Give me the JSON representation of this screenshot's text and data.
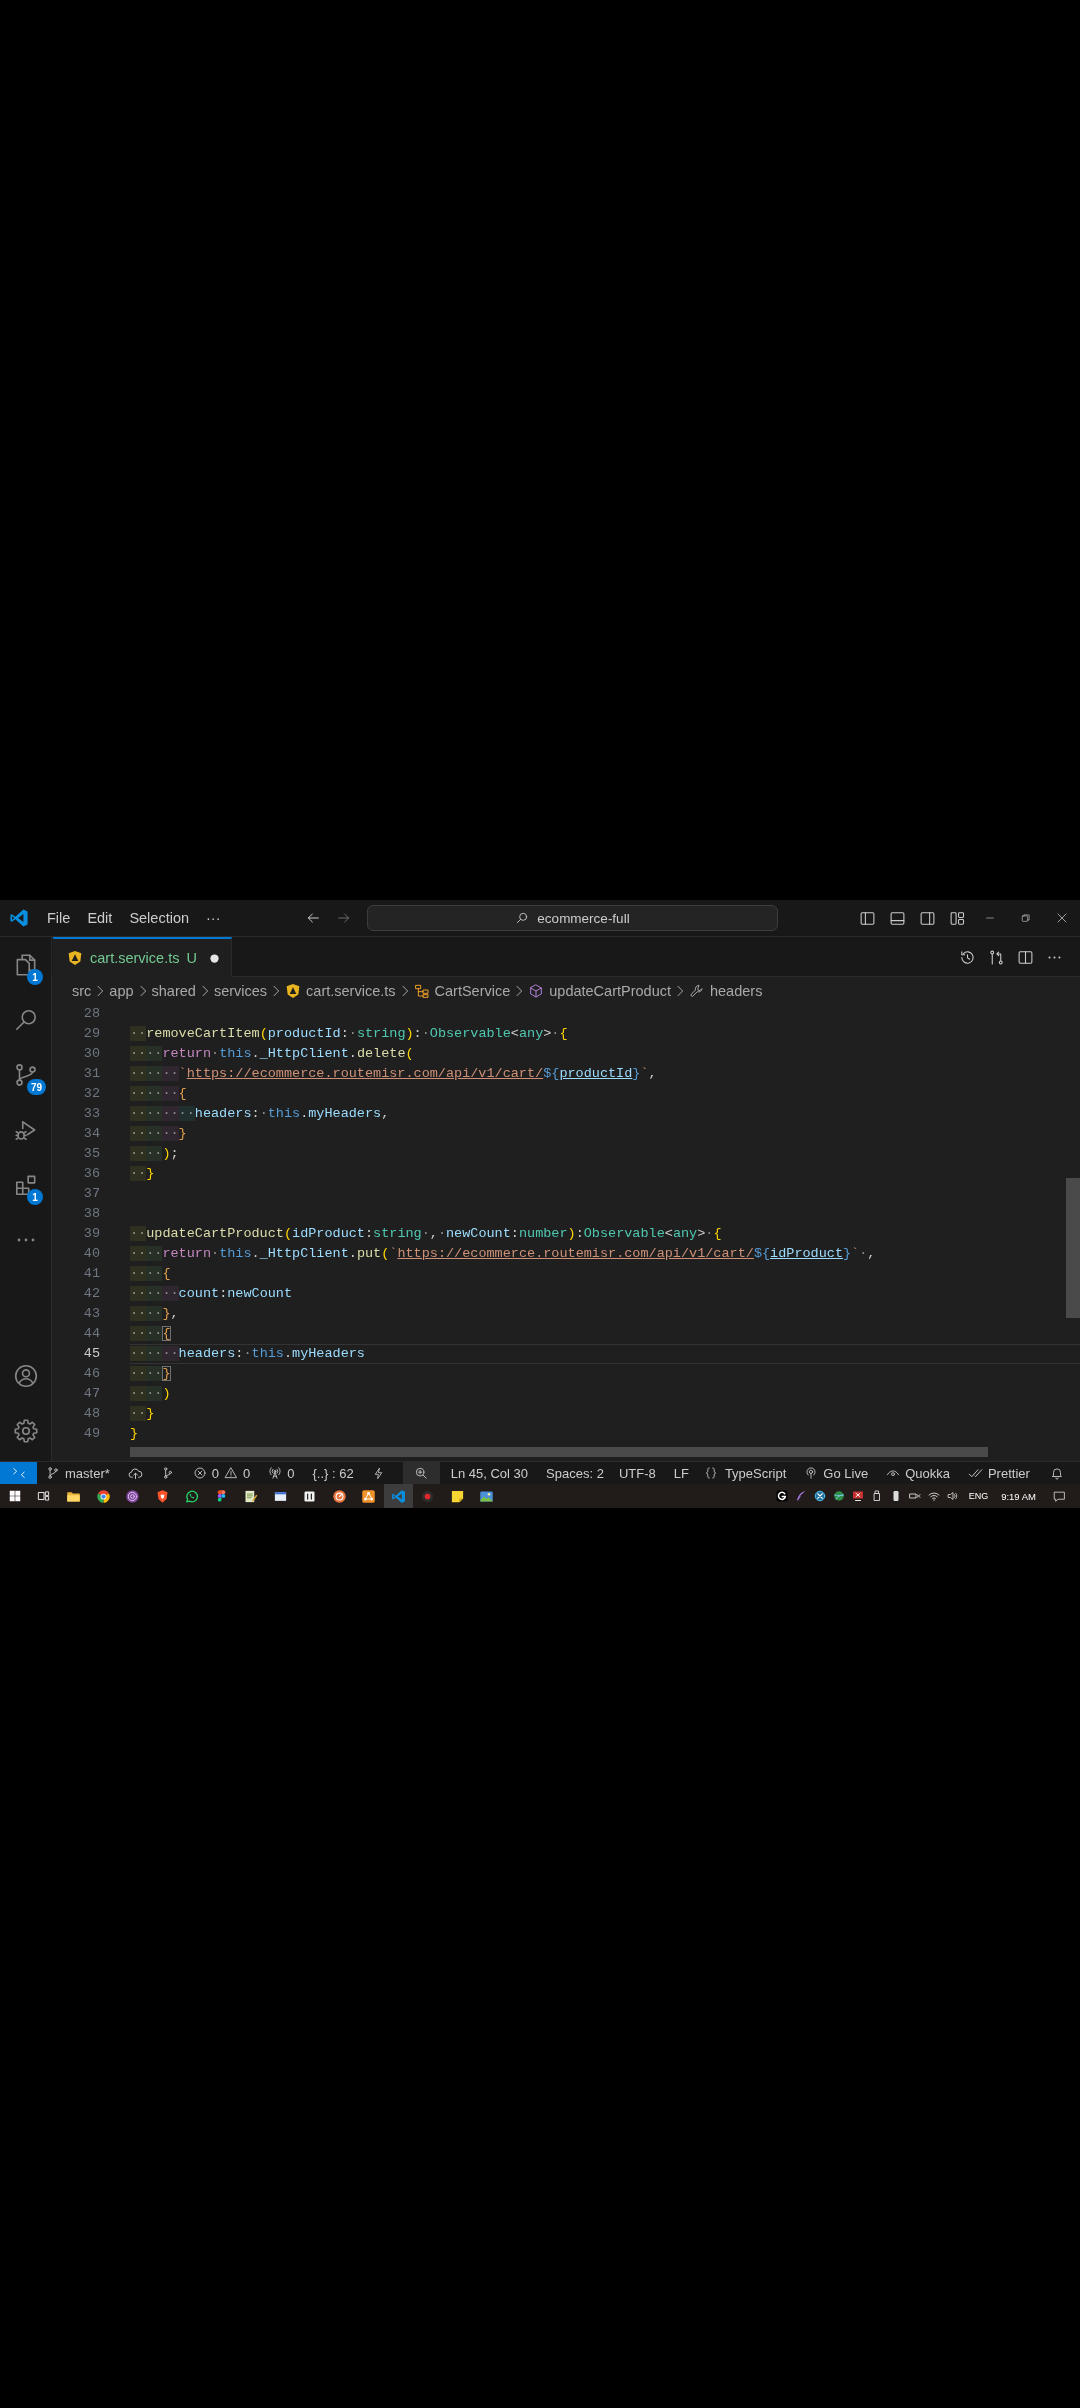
{
  "title_bar": {
    "menu": [
      {
        "label": "File"
      },
      {
        "label": "Edit"
      },
      {
        "label": "Selection"
      },
      {
        "label": "···"
      }
    ],
    "command_center": "ecommerce-full"
  },
  "activity_bar": {
    "views": [
      {
        "selected": false,
        "badge": "1"
      },
      {
        "selected": false
      },
      {
        "selected": false,
        "badge": "79"
      },
      {
        "selected": false
      },
      {
        "selected": false,
        "badge": "1"
      }
    ]
  },
  "tabs": [
    {
      "label": "cart.service.ts",
      "git_status": "U",
      "modified": true,
      "selected": true
    }
  ],
  "breadcrumbs": [
    {
      "kind": "folder",
      "label": "src"
    },
    {
      "kind": "folder",
      "label": "app"
    },
    {
      "kind": "folder",
      "label": "shared"
    },
    {
      "kind": "folder",
      "label": "services"
    },
    {
      "kind": "file",
      "label": "cart.service.ts"
    },
    {
      "kind": "class",
      "label": "CartService"
    },
    {
      "kind": "method",
      "label": "updateCartProduct"
    },
    {
      "kind": "property",
      "label": "headers"
    }
  ],
  "editor": {
    "lines": [
      {
        "number": "28",
        "current": false
      },
      {
        "number": "29",
        "current": false,
        "tokens": [
          {
            "kind": "ind",
            "text": "··"
          },
          {
            "kind": "fn",
            "text": "removeCartItem"
          },
          {
            "kind": "b1",
            "text": "("
          },
          {
            "kind": "var",
            "text": "productId"
          },
          {
            "kind": "p",
            "text": ":"
          },
          {
            "kind": "ws",
            "text": "·"
          },
          {
            "kind": "type",
            "text": "string"
          },
          {
            "kind": "b1",
            "text": ")"
          },
          {
            "kind": "p",
            "text": ":"
          },
          {
            "kind": "ws",
            "text": "·"
          },
          {
            "kind": "type",
            "text": "Observable"
          },
          {
            "kind": "p",
            "text": "<"
          },
          {
            "kind": "type",
            "text": "any"
          },
          {
            "kind": "p",
            "text": ">"
          },
          {
            "kind": "ws",
            "text": "·"
          },
          {
            "kind": "b1",
            "text": "{"
          }
        ]
      },
      {
        "number": "30",
        "current": false,
        "tokens": [
          {
            "kind": "ind",
            "text": "··"
          },
          {
            "kind": "ind",
            "text": "··"
          },
          {
            "kind": "kw",
            "text": "return"
          },
          {
            "kind": "ws",
            "text": "·"
          },
          {
            "kind": "this",
            "text": "this"
          },
          {
            "kind": "p",
            "text": "."
          },
          {
            "kind": "var",
            "text": "_HttpClient"
          },
          {
            "kind": "p",
            "text": "."
          },
          {
            "kind": "fn",
            "text": "delete"
          },
          {
            "kind": "b1",
            "text": "("
          }
        ]
      },
      {
        "number": "31",
        "current": false,
        "tokens": [
          {
            "kind": "ind",
            "text": "··"
          },
          {
            "kind": "ind",
            "text": "··"
          },
          {
            "kind": "ind",
            "text": "··"
          },
          {
            "kind": "str",
            "text": "`"
          },
          {
            "kind": "url",
            "text": "https://ecommerce.routemisr.com/api/v1/cart/"
          },
          {
            "kind": "tpl",
            "text": "${"
          },
          {
            "kind": "uvar",
            "text": "productId"
          },
          {
            "kind": "tpl",
            "text": "}"
          },
          {
            "kind": "str",
            "text": "`"
          },
          {
            "kind": "p",
            "text": ","
          }
        ]
      },
      {
        "number": "32",
        "current": false,
        "tokens": [
          {
            "kind": "ind",
            "text": "··"
          },
          {
            "kind": "ind",
            "text": "··"
          },
          {
            "kind": "ind",
            "text": "··"
          },
          {
            "kind": "b2",
            "text": "{"
          }
        ]
      },
      {
        "number": "33",
        "current": false,
        "tokens": [
          {
            "kind": "ind",
            "text": "··"
          },
          {
            "kind": "ind",
            "text": "··"
          },
          {
            "kind": "ind",
            "text": "··"
          },
          {
            "kind": "ind",
            "text": "··"
          },
          {
            "kind": "var",
            "text": "headers"
          },
          {
            "kind": "p",
            "text": ":"
          },
          {
            "kind": "ws",
            "text": "·"
          },
          {
            "kind": "this",
            "text": "this"
          },
          {
            "kind": "p",
            "text": "."
          },
          {
            "kind": "var",
            "text": "myHeaders"
          },
          {
            "kind": "p",
            "text": ","
          }
        ]
      },
      {
        "number": "34",
        "current": false,
        "tokens": [
          {
            "kind": "ind",
            "text": "··"
          },
          {
            "kind": "ind",
            "text": "··"
          },
          {
            "kind": "ind",
            "text": "··"
          },
          {
            "kind": "b2",
            "text": "}"
          }
        ]
      },
      {
        "number": "35",
        "current": false,
        "tokens": [
          {
            "kind": "ind",
            "text": "··"
          },
          {
            "kind": "ind",
            "text": "··"
          },
          {
            "kind": "b1",
            "text": ")"
          },
          {
            "kind": "p",
            "text": ";"
          }
        ]
      },
      {
        "number": "36",
        "current": false,
        "tokens": [
          {
            "kind": "ind",
            "text": "··"
          },
          {
            "kind": "b1",
            "text": "}"
          }
        ]
      },
      {
        "number": "37",
        "current": false
      },
      {
        "number": "38",
        "current": false
      },
      {
        "number": "39",
        "current": false,
        "tokens": [
          {
            "kind": "ind",
            "text": "··"
          },
          {
            "kind": "fn",
            "text": "updateCartProduct"
          },
          {
            "kind": "b1",
            "text": "("
          },
          {
            "kind": "var",
            "text": "idProduct"
          },
          {
            "kind": "p",
            "text": ":"
          },
          {
            "kind": "type",
            "text": "string"
          },
          {
            "kind": "ws",
            "text": "·"
          },
          {
            "kind": "p",
            "text": ","
          },
          {
            "kind": "ws",
            "text": "·"
          },
          {
            "kind": "var",
            "text": "newCount"
          },
          {
            "kind": "p",
            "text": ":"
          },
          {
            "kind": "type",
            "text": "number"
          },
          {
            "kind": "b1",
            "text": ")"
          },
          {
            "kind": "p",
            "text": ":"
          },
          {
            "kind": "type",
            "text": "Observable"
          },
          {
            "kind": "p",
            "text": "<"
          },
          {
            "kind": "type",
            "text": "any"
          },
          {
            "kind": "p",
            "text": ">"
          },
          {
            "kind": "ws",
            "text": "·"
          },
          {
            "kind": "b1",
            "text": "{"
          }
        ]
      },
      {
        "number": "40",
        "current": false,
        "tokens": [
          {
            "kind": "ind",
            "text": "··"
          },
          {
            "kind": "ind",
            "text": "··"
          },
          {
            "kind": "kw",
            "text": "return"
          },
          {
            "kind": "ws",
            "text": "·"
          },
          {
            "kind": "this",
            "text": "this"
          },
          {
            "kind": "p",
            "text": "."
          },
          {
            "kind": "var",
            "text": "_HttpClient"
          },
          {
            "kind": "p",
            "text": "."
          },
          {
            "kind": "fn",
            "text": "put"
          },
          {
            "kind": "b1",
            "text": "("
          },
          {
            "kind": "str",
            "text": "`"
          },
          {
            "kind": "url",
            "text": "https://ecommerce.routemisr.com/api/v1/cart/"
          },
          {
            "kind": "tpl",
            "text": "${"
          },
          {
            "kind": "uvar",
            "text": "idProduct"
          },
          {
            "kind": "tpl",
            "text": "}"
          },
          {
            "kind": "str",
            "text": "`"
          },
          {
            "kind": "ws",
            "text": "·"
          },
          {
            "kind": "p",
            "text": ","
          }
        ]
      },
      {
        "number": "41",
        "current": false,
        "tokens": [
          {
            "kind": "ind",
            "text": "··"
          },
          {
            "kind": "ind",
            "text": "··"
          },
          {
            "kind": "b2",
            "text": "{"
          }
        ]
      },
      {
        "number": "42",
        "current": false,
        "tokens": [
          {
            "kind": "ind",
            "text": "··"
          },
          {
            "kind": "ind",
            "text": "··"
          },
          {
            "kind": "ind",
            "text": "··"
          },
          {
            "kind": "var",
            "text": "count"
          },
          {
            "kind": "p",
            "text": ":"
          },
          {
            "kind": "var",
            "text": "newCount"
          }
        ]
      },
      {
        "number": "43",
        "current": false,
        "tokens": [
          {
            "kind": "ind",
            "text": "··"
          },
          {
            "kind": "ind",
            "text": "··"
          },
          {
            "kind": "b2",
            "text": "}"
          },
          {
            "kind": "p",
            "text": ","
          }
        ]
      },
      {
        "number": "44",
        "current": false,
        "tokens": [
          {
            "kind": "ind",
            "text": "··"
          },
          {
            "kind": "ind",
            "text": "··"
          },
          {
            "kind": "bm",
            "text": "{"
          }
        ]
      },
      {
        "number": "45",
        "current": true,
        "tokens": [
          {
            "kind": "ind",
            "text": "··"
          },
          {
            "kind": "ind",
            "text": "··"
          },
          {
            "kind": "ind",
            "text": "··"
          },
          {
            "kind": "var",
            "text": "headers"
          },
          {
            "kind": "p",
            "text": ":"
          },
          {
            "kind": "ws",
            "text": "·"
          },
          {
            "kind": "this",
            "text": "this"
          },
          {
            "kind": "p",
            "text": "."
          },
          {
            "kind": "var",
            "text": "myHeaders"
          }
        ]
      },
      {
        "number": "46",
        "current": false,
        "tokens": [
          {
            "kind": "ind",
            "text": "··"
          },
          {
            "kind": "ind",
            "text": "··"
          },
          {
            "kind": "bm",
            "text": "}"
          }
        ]
      },
      {
        "number": "47",
        "current": false,
        "tokens": [
          {
            "kind": "ind",
            "text": "··"
          },
          {
            "kind": "ind",
            "text": "··"
          },
          {
            "kind": "b1",
            "text": ")"
          }
        ]
      },
      {
        "number": "48",
        "current": false,
        "tokens": [
          {
            "kind": "ind",
            "text": "··"
          },
          {
            "kind": "b1",
            "text": "}"
          }
        ]
      },
      {
        "number": "49",
        "current": false,
        "tokens": [
          {
            "kind": "b1",
            "text": "}"
          }
        ]
      }
    ]
  },
  "status_bar": {
    "branch": "master*",
    "errors": "0",
    "warnings": "0",
    "ports": "0",
    "brackets": "{..} : 62",
    "cursor": "Ln 45, Col 30",
    "indentation": "Spaces: 2",
    "encoding": "UTF-8",
    "eol": "LF",
    "language": "TypeScript",
    "go_live": "Go Live",
    "quokka": "Quokka",
    "prettier": "Prettier"
  },
  "taskbar": {
    "apps": [
      {
        "selected": false
      },
      {
        "selected": false
      },
      {
        "selected": false
      },
      {
        "selected": false
      },
      {
        "selected": false
      },
      {
        "selected": false
      },
      {
        "selected": false
      },
      {
        "selected": false
      },
      {
        "selected": false
      },
      {
        "selected": false
      },
      {
        "selected": false
      },
      {
        "selected": true
      },
      {
        "selected": false
      },
      {
        "selected": false
      },
      {
        "selected": false
      }
    ],
    "language": "ENG",
    "time": "9:19 AM"
  }
}
